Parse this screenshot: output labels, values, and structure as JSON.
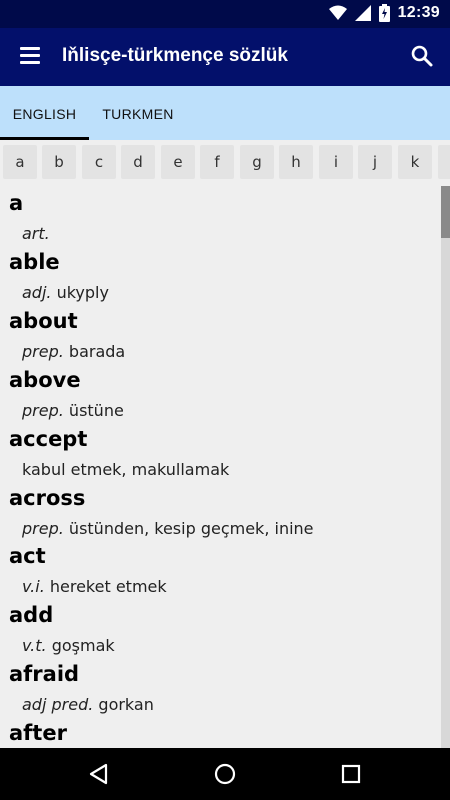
{
  "status": {
    "time": "12:39"
  },
  "toolbar": {
    "title": "Iňlisçe-türkmençe sözlük"
  },
  "tabs": [
    {
      "label": "ENGLISH"
    },
    {
      "label": "TURKMEN"
    }
  ],
  "letters": [
    "a",
    "b",
    "c",
    "d",
    "e",
    "f",
    "g",
    "h",
    "i",
    "j",
    "k"
  ],
  "entries": [
    {
      "word": "a",
      "pos": "art.",
      "translation": ""
    },
    {
      "word": "able",
      "pos": "adj.",
      "translation": "ukyply"
    },
    {
      "word": "about",
      "pos": "prep.",
      "translation": "barada"
    },
    {
      "word": "above",
      "pos": "prep.",
      "translation": "üstüne"
    },
    {
      "word": "accept",
      "pos": "",
      "translation": "kabul etmek, makullamak"
    },
    {
      "word": "across",
      "pos": "prep.",
      "translation": "üstünden, kesip geçmek, inine"
    },
    {
      "word": "act",
      "pos": "v.i.",
      "translation": "hereket etmek"
    },
    {
      "word": "add",
      "pos": "v.t.",
      "translation": "goşmak"
    },
    {
      "word": "afraid",
      "pos": "adj pred.",
      "translation": "gorkan"
    },
    {
      "word": "after",
      "pos": "",
      "translation": ""
    }
  ],
  "colors": {
    "statusbar": "#000a4a",
    "toolbar": "#03106b",
    "tabs": "#bde0fb"
  }
}
